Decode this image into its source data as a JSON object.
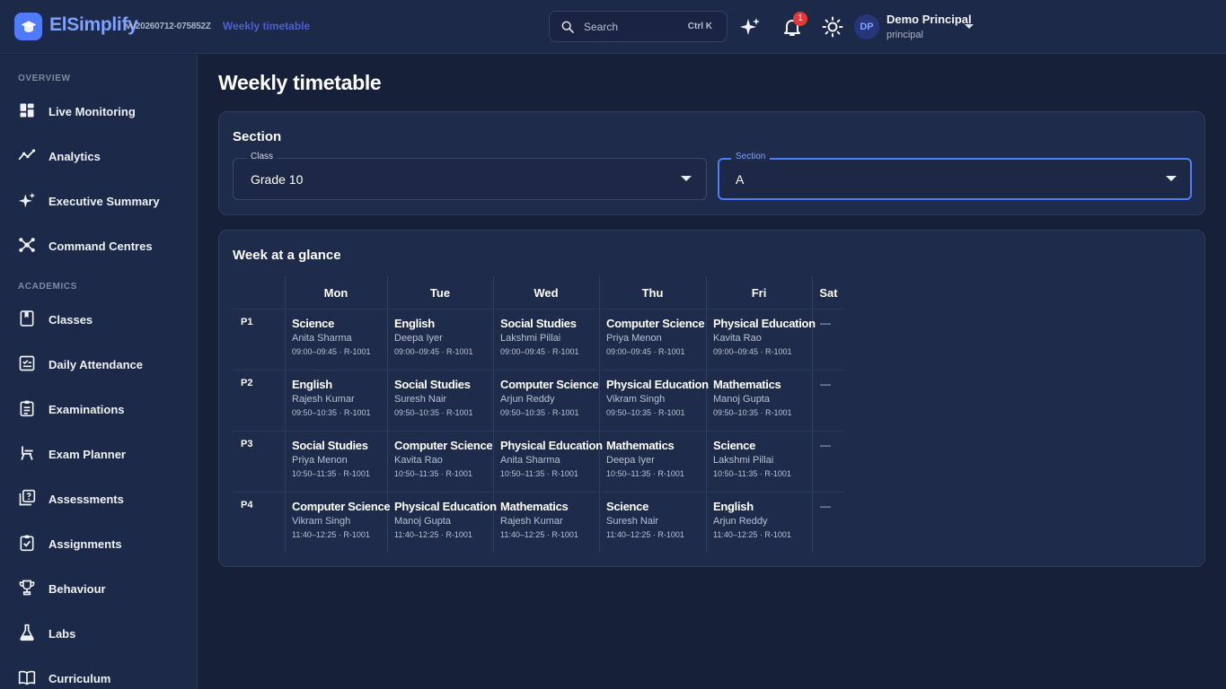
{
  "header": {
    "brand": "ElSimplify",
    "version": "vv20260712-075852Z",
    "breadcrumb": "Weekly timetable",
    "search_placeholder": "Search",
    "search_shortcut": "Ctrl K",
    "notification_count": "1",
    "user": {
      "initials": "DP",
      "name": "Demo Principal",
      "role": "principal"
    }
  },
  "sidebar": {
    "sections": [
      {
        "label": "OVERVIEW",
        "items": [
          "Live Monitoring",
          "Analytics",
          "Executive Summary",
          "Command Centres"
        ]
      },
      {
        "label": "ACADEMICS",
        "items": [
          "Classes",
          "Daily Attendance",
          "Examinations",
          "Exam Planner",
          "Assessments",
          "Assignments",
          "Behaviour",
          "Labs",
          "Curriculum"
        ]
      }
    ]
  },
  "main": {
    "title": "Weekly timetable",
    "section_card": {
      "title": "Section",
      "class_label": "Class",
      "class_value": "Grade 10",
      "section_label": "Section",
      "section_value": "A"
    },
    "week_card": {
      "title": "Week at a glance",
      "days": [
        "Mon",
        "Tue",
        "Wed",
        "Thu",
        "Fri",
        "Sat"
      ],
      "empty_marker": "—",
      "periods": [
        {
          "label": "P1",
          "time": "09:00–09:45 · R-1001",
          "cells": [
            {
              "subject": "Science",
              "teacher": "Anita Sharma"
            },
            {
              "subject": "English",
              "teacher": "Deepa Iyer"
            },
            {
              "subject": "Social Studies",
              "teacher": "Lakshmi Pillai"
            },
            {
              "subject": "Computer Science",
              "teacher": "Priya Menon"
            },
            {
              "subject": "Physical Education",
              "teacher": "Kavita Rao"
            }
          ]
        },
        {
          "label": "P2",
          "time": "09:50–10:35 · R-1001",
          "cells": [
            {
              "subject": "English",
              "teacher": "Rajesh Kumar"
            },
            {
              "subject": "Social Studies",
              "teacher": "Suresh Nair"
            },
            {
              "subject": "Computer Science",
              "teacher": "Arjun Reddy"
            },
            {
              "subject": "Physical Education",
              "teacher": "Vikram Singh"
            },
            {
              "subject": "Mathematics",
              "teacher": "Manoj Gupta"
            }
          ]
        },
        {
          "label": "P3",
          "time": "10:50–11:35 · R-1001",
          "cells": [
            {
              "subject": "Social Studies",
              "teacher": "Priya Menon"
            },
            {
              "subject": "Computer Science",
              "teacher": "Kavita Rao"
            },
            {
              "subject": "Physical Education",
              "teacher": "Anita Sharma"
            },
            {
              "subject": "Mathematics",
              "teacher": "Deepa Iyer"
            },
            {
              "subject": "Science",
              "teacher": "Lakshmi Pillai"
            }
          ]
        },
        {
          "label": "P4",
          "time": "11:40–12:25 · R-1001",
          "cells": [
            {
              "subject": "Computer Science",
              "teacher": "Vikram Singh"
            },
            {
              "subject": "Physical Education",
              "teacher": "Manoj Gupta"
            },
            {
              "subject": "Mathematics",
              "teacher": "Rajesh Kumar"
            },
            {
              "subject": "Science",
              "teacher": "Suresh Nair"
            },
            {
              "subject": "English",
              "teacher": "Arjun Reddy"
            }
          ]
        }
      ]
    }
  },
  "icons": {
    "logo": "graduation-cap-icon",
    "search": "search-icon",
    "ai": "sparkles-icon",
    "notifications": "bell-icon",
    "theme": "sun-icon",
    "menu": "chevron-down-icon"
  },
  "colors": {
    "accent": "#4f7bff",
    "brand_text": "#7da2ff",
    "badge": "#e53935"
  }
}
